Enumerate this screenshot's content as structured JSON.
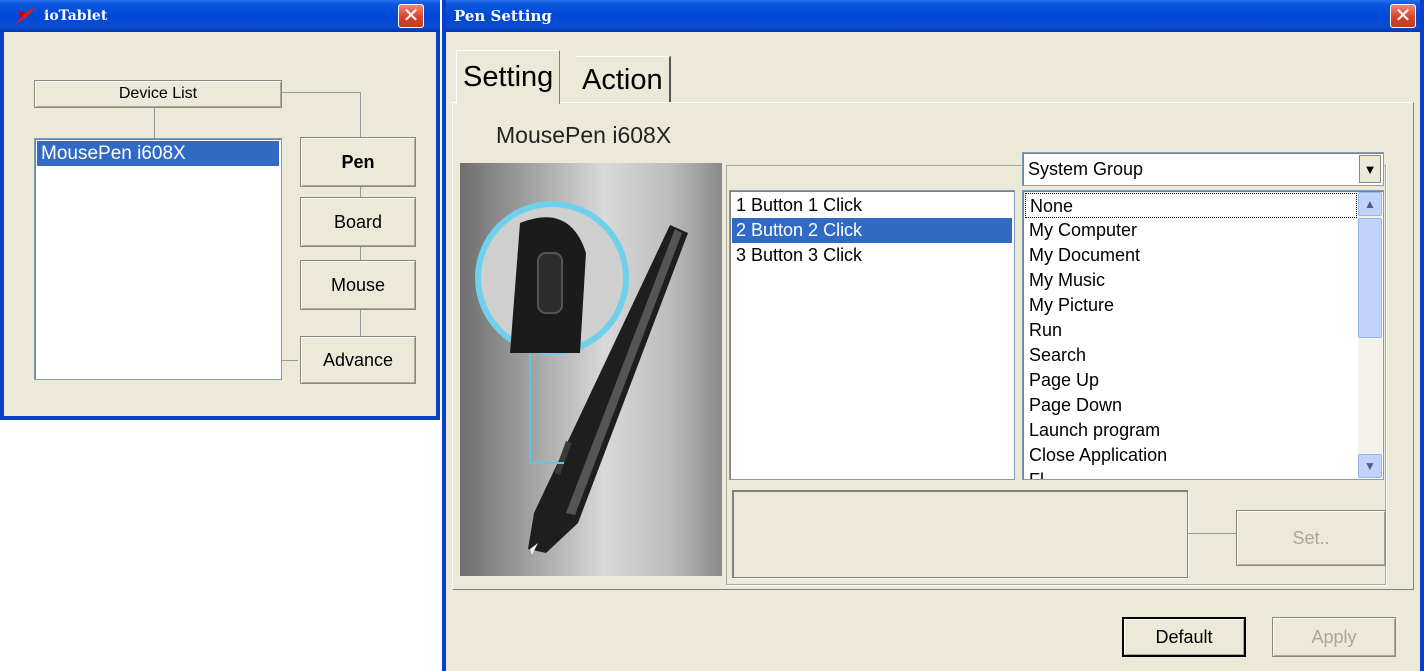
{
  "io_window": {
    "title": "ioTablet",
    "device_list_label": "Device List",
    "devices": [
      "MousePen i608X"
    ],
    "buttons": {
      "pen": "Pen",
      "board": "Board",
      "mouse": "Mouse",
      "advance": "Advance"
    }
  },
  "pen_window": {
    "title": "Pen Setting",
    "tabs": [
      "Setting",
      "Action"
    ],
    "device_name": "MousePen i608X",
    "button_actions": [
      "1  Button 1 Click",
      "2  Button 2 Click",
      "3  Button 3 Click"
    ],
    "group_select": "System Group",
    "functions": [
      "None",
      "My Computer",
      "My Document",
      "My Music",
      "My Picture",
      "Run",
      "Search",
      "Page Up",
      "Page Down",
      "Launch program",
      "Close Application",
      "Fl..."
    ],
    "set_label": "Set..",
    "default_label": "Default",
    "apply_label": "Apply"
  },
  "colors": {
    "titlebar": "#0048d8",
    "selection": "#316ac5",
    "dialog": "#ece9d8"
  },
  "icons": {
    "app_logo": "ink-pen-icon",
    "close": "close-icon"
  }
}
